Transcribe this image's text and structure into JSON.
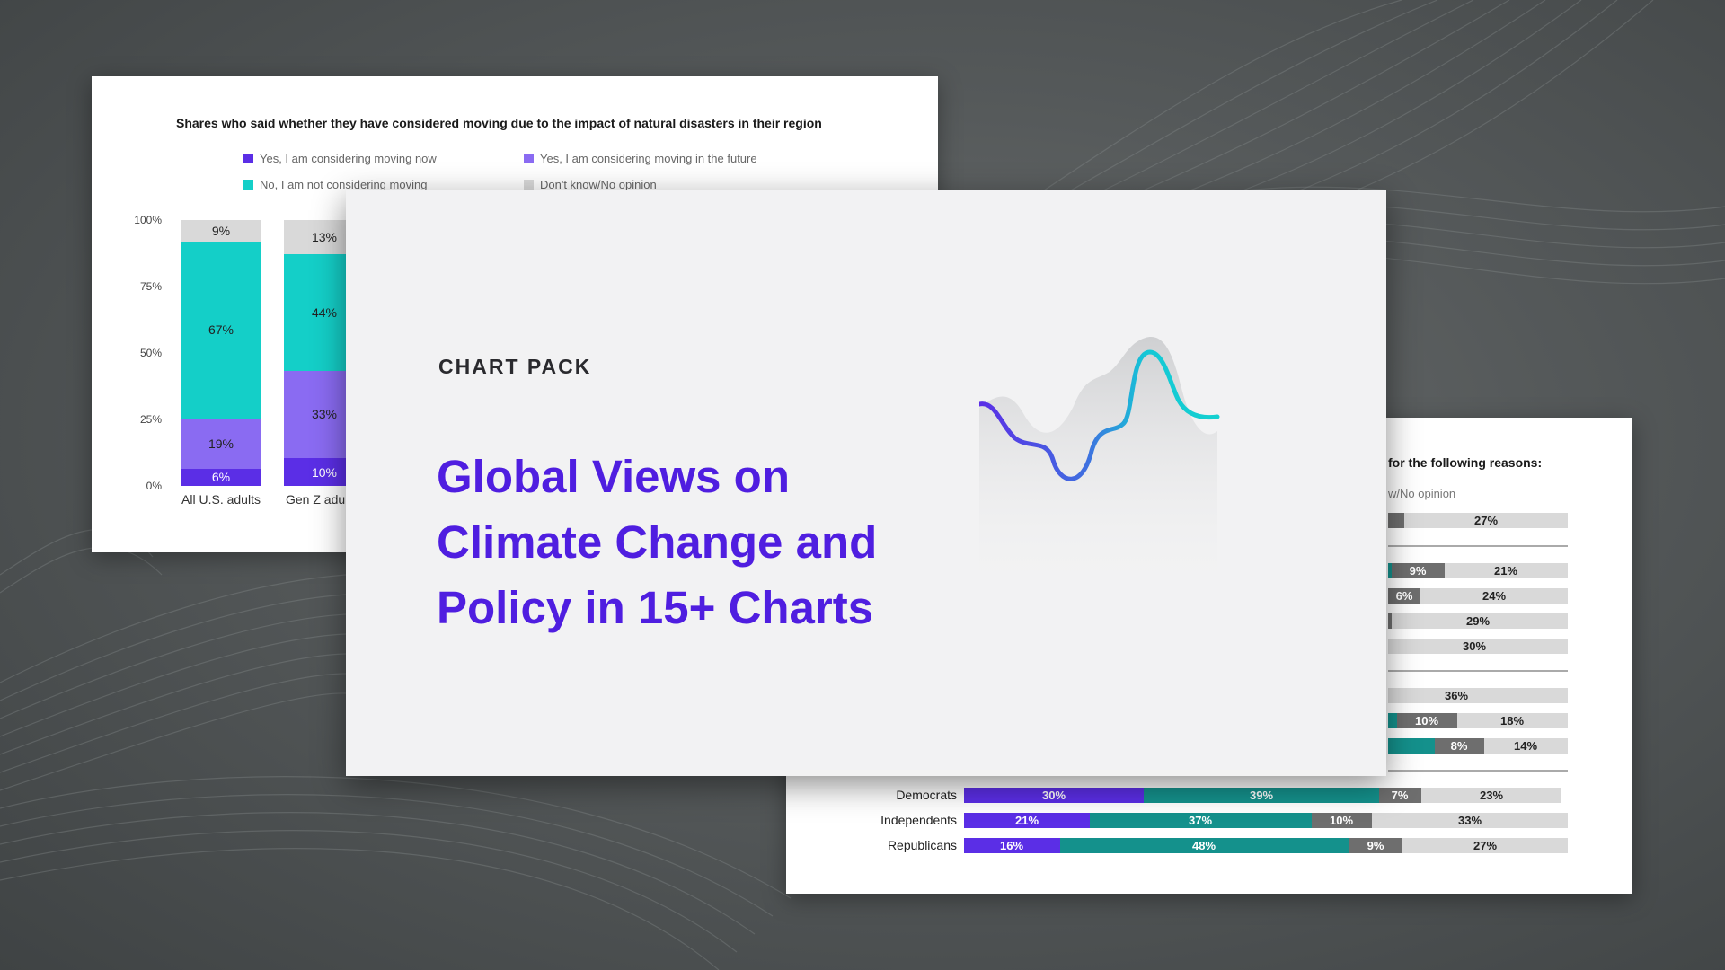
{
  "main_card": {
    "eyebrow": "CHART PACK",
    "headline_lines": [
      "Global Views on",
      "Climate Change and",
      "Policy in 15+ Charts"
    ],
    "accent_color": "#4f1ee0",
    "sparkline_colors": [
      "#5b2ee6",
      "#14d0d0"
    ]
  },
  "left_card": {
    "title": "Shares who said whether they have considered moving due to the impact of natural disasters in their region",
    "legend": [
      {
        "label": "Yes, I am considering moving now",
        "color": "#5b2ee6"
      },
      {
        "label": "Yes, I am considering moving in the future",
        "color": "#8a6bf2"
      },
      {
        "label": "No, I am not considering moving",
        "color": "#14cfc8"
      },
      {
        "label": "Don't know/No opinion",
        "color": "#d9d9d9"
      }
    ],
    "y_ticks": [
      "100%",
      "75%",
      "50%",
      "25%",
      "0%"
    ],
    "bars": [
      {
        "category": "All U.S. adults",
        "labels": [
          "6%",
          "19%",
          "67%",
          "9%"
        ]
      },
      {
        "category": "Gen Z adu",
        "labels": [
          "10%",
          "33%",
          "44%",
          "13%"
        ]
      }
    ]
  },
  "right_card": {
    "title_fragment": "for the following reasons:",
    "legend_fragment": "w/No opinion",
    "fragment_rows": [
      {
        "labels": [
          "27%"
        ]
      },
      {
        "labels": [
          "9%",
          "21%"
        ]
      },
      {
        "labels": [
          "6%",
          "24%"
        ]
      },
      {
        "labels": [
          "29%"
        ]
      },
      {
        "labels": [
          "30%"
        ]
      },
      {
        "labels": [
          "36%"
        ]
      },
      {
        "labels": [
          "10%",
          "18%"
        ]
      },
      {
        "labels": [
          "8%",
          "14%"
        ]
      }
    ],
    "party_rows": [
      {
        "label": "Democrats",
        "labels": [
          "30%",
          "39%",
          "7%",
          "23%"
        ]
      },
      {
        "label": "Independents",
        "labels": [
          "21%",
          "37%",
          "10%",
          "33%"
        ]
      },
      {
        "label": "Republicans",
        "labels": [
          "16%",
          "48%",
          "9%",
          "27%"
        ]
      }
    ],
    "colors": [
      "#5b2ee6",
      "#14918c",
      "#6e6e6e",
      "#d9d9d9"
    ]
  }
}
